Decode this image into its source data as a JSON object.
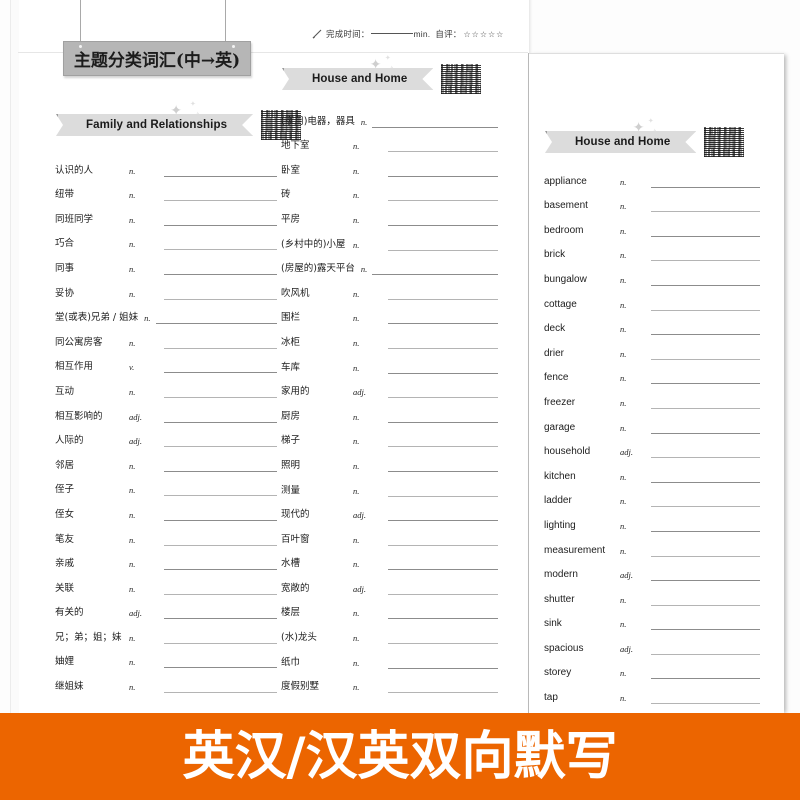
{
  "plaque": {
    "title": "主题分类词汇(中→英)"
  },
  "time_strip": {
    "pencil_icon": "pencil-icon",
    "label_time": "完成时间：",
    "unit": "min.",
    "label_rating": "自评：",
    "stars": "☆☆☆☆☆"
  },
  "banners": {
    "family": "Family and Relationships",
    "house_middle": "House and Home",
    "house_right": "House and Home"
  },
  "pos": {
    "n": "n.",
    "v": "v.",
    "adj": "adj."
  },
  "lists": {
    "zh_left": [
      {
        "term": "认识的人",
        "pos": "n."
      },
      {
        "term": "纽带",
        "pos": "n."
      },
      {
        "term": "同班同学",
        "pos": "n."
      },
      {
        "term": "巧合",
        "pos": "n."
      },
      {
        "term": "同事",
        "pos": "n."
      },
      {
        "term": "妥协",
        "pos": "n."
      },
      {
        "term": "堂(或表)兄弟 / 姐妹",
        "pos": "n.",
        "wide": true
      },
      {
        "term": "同公寓房客",
        "pos": "n."
      },
      {
        "term": "相互作用",
        "pos": "v."
      },
      {
        "term": "互动",
        "pos": "n."
      },
      {
        "term": "相互影响的",
        "pos": "adj."
      },
      {
        "term": "人际的",
        "pos": "adj."
      },
      {
        "term": "邻居",
        "pos": "n."
      },
      {
        "term": "侄子",
        "pos": "n."
      },
      {
        "term": "侄女",
        "pos": "n."
      },
      {
        "term": "笔友",
        "pos": "n."
      },
      {
        "term": "亲戚",
        "pos": "n."
      },
      {
        "term": "关联",
        "pos": "n."
      },
      {
        "term": "有关的",
        "pos": "adj."
      },
      {
        "term": "兄；弟；姐；妹",
        "pos": "n."
      },
      {
        "term": "妯娌",
        "pos": "n."
      },
      {
        "term": "继姐妹",
        "pos": "n."
      }
    ],
    "zh_middle": [
      {
        "term": "(家用)电器，器具",
        "pos": "n.",
        "wide": true
      },
      {
        "term": "地下室",
        "pos": "n."
      },
      {
        "term": "卧室",
        "pos": "n."
      },
      {
        "term": "砖",
        "pos": "n."
      },
      {
        "term": "平房",
        "pos": "n."
      },
      {
        "term": "(乡村中的)小屋",
        "pos": "n."
      },
      {
        "term": "(房屋的)露天平台",
        "pos": "n.",
        "wide": true
      },
      {
        "term": "吹风机",
        "pos": "n."
      },
      {
        "term": "围栏",
        "pos": "n."
      },
      {
        "term": "冰柜",
        "pos": "n."
      },
      {
        "term": "车库",
        "pos": "n."
      },
      {
        "term": "家用的",
        "pos": "adj."
      },
      {
        "term": "厨房",
        "pos": "n."
      },
      {
        "term": "梯子",
        "pos": "n."
      },
      {
        "term": "照明",
        "pos": "n."
      },
      {
        "term": "测量",
        "pos": "n."
      },
      {
        "term": "现代的",
        "pos": "adj."
      },
      {
        "term": "百叶窗",
        "pos": "n."
      },
      {
        "term": "水槽",
        "pos": "n."
      },
      {
        "term": "宽敞的",
        "pos": "adj."
      },
      {
        "term": "楼层",
        "pos": "n."
      },
      {
        "term": "(水)龙头",
        "pos": "n."
      },
      {
        "term": "纸巾",
        "pos": "n."
      },
      {
        "term": "度假别墅",
        "pos": "n."
      }
    ],
    "en_right": [
      {
        "term": "appliance",
        "pos": "n."
      },
      {
        "term": "basement",
        "pos": "n."
      },
      {
        "term": "bedroom",
        "pos": "n."
      },
      {
        "term": "brick",
        "pos": "n."
      },
      {
        "term": "bungalow",
        "pos": "n."
      },
      {
        "term": "cottage",
        "pos": "n."
      },
      {
        "term": "deck",
        "pos": "n."
      },
      {
        "term": "drier",
        "pos": "n."
      },
      {
        "term": "fence",
        "pos": "n."
      },
      {
        "term": "freezer",
        "pos": "n."
      },
      {
        "term": "garage",
        "pos": "n."
      },
      {
        "term": "household",
        "pos": "adj."
      },
      {
        "term": "kitchen",
        "pos": "n."
      },
      {
        "term": "ladder",
        "pos": "n."
      },
      {
        "term": "lighting",
        "pos": "n."
      },
      {
        "term": "measurement",
        "pos": "n."
      },
      {
        "term": "modern",
        "pos": "adj."
      },
      {
        "term": "shutter",
        "pos": "n."
      },
      {
        "term": "sink",
        "pos": "n."
      },
      {
        "term": "spacious",
        "pos": "adj."
      },
      {
        "term": "storey",
        "pos": "n."
      },
      {
        "term": "tap",
        "pos": "n."
      }
    ]
  },
  "orange_banner": {
    "text": "英汉/汉英双向默写",
    "color": "#ec6500"
  }
}
